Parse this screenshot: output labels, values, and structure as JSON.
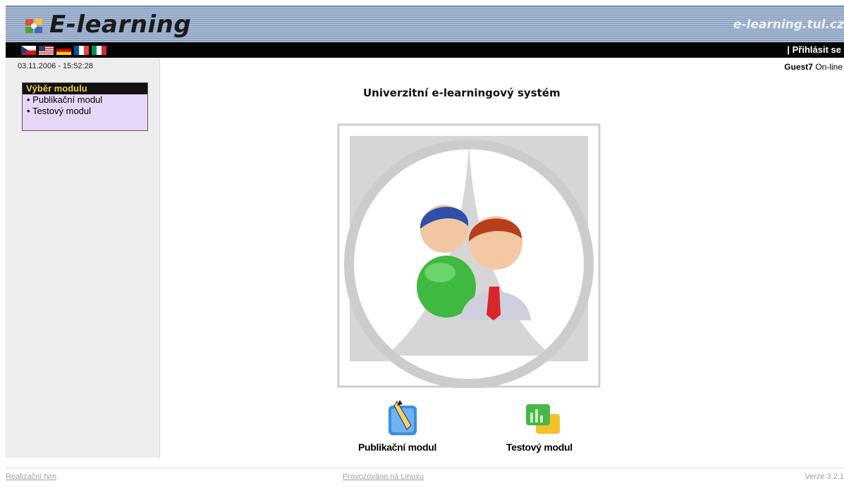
{
  "header": {
    "logo_text": "E-learning",
    "site_url": "e-learning.tul.cz"
  },
  "topbar": {
    "flags": [
      "cz-flag",
      "us-flag",
      "de-flag",
      "fr-flag",
      "it-flag"
    ],
    "login_label": "| Přihlásit se"
  },
  "status": {
    "datetime": "03.11.2006 - 15:52:28",
    "user_name": "Guest7",
    "user_status": "On-line"
  },
  "sidebar": {
    "module_heading": "Výběr modulu",
    "items": [
      {
        "label": "Publikační modul"
      },
      {
        "label": "Testový modul"
      }
    ]
  },
  "main": {
    "title": "Univerzitní e-learningový systém",
    "tiles": [
      {
        "label": "Publikační modul",
        "icon": "pen-icon"
      },
      {
        "label": "Testový modul",
        "icon": "test-chart-icon"
      }
    ]
  },
  "footer": {
    "left_link": "Realizační tým",
    "center_link": "Provozováno na Linuxu",
    "version": "Verze 3.2.1"
  },
  "colors": {
    "header_blue": "#9bb0cf",
    "menu_bg": "#e6d6f8",
    "menu_heading": "#f2cc44",
    "sidebar_bg": "#ededed"
  }
}
